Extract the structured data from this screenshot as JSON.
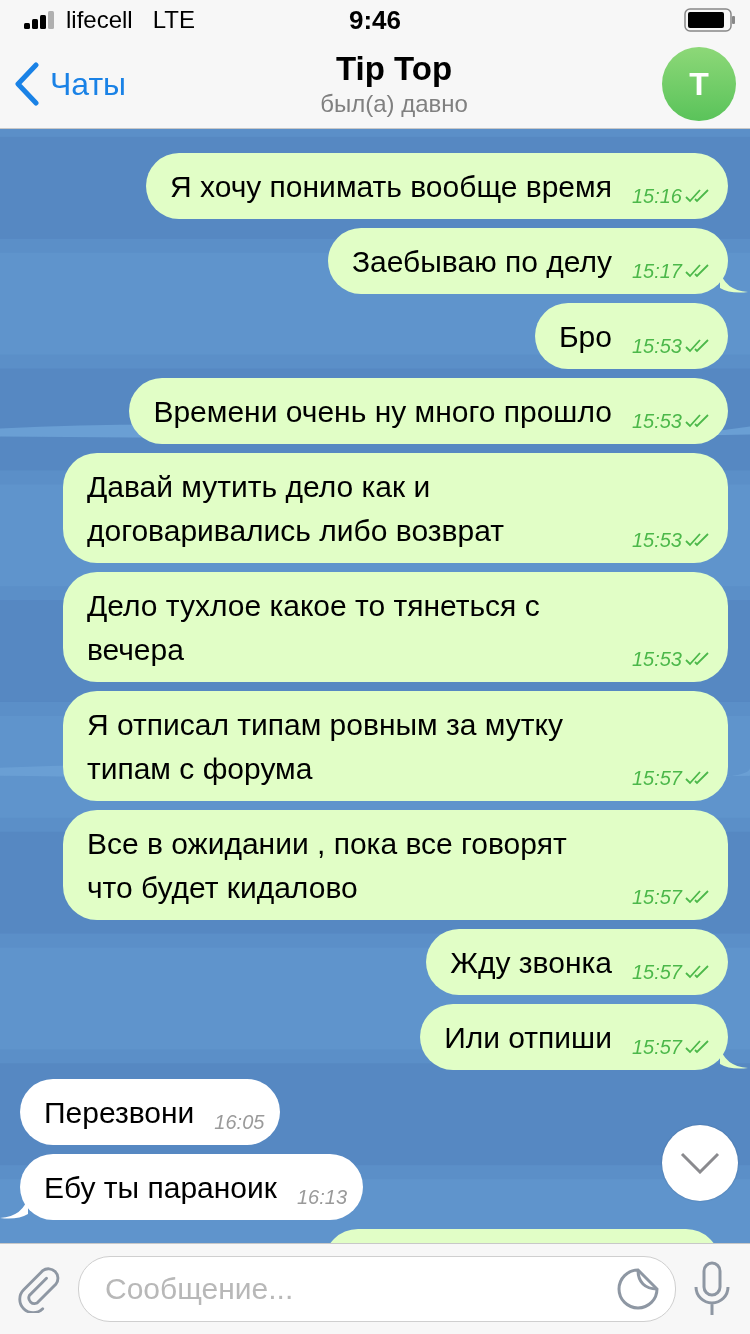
{
  "status_bar": {
    "carrier": "lifecell",
    "network": "LTE",
    "time": "9:46"
  },
  "header": {
    "back_label": "Чаты",
    "title": "Tip Top",
    "subtitle": "был(а) давно",
    "avatar_letter": "T"
  },
  "chat": {
    "messages": [
      {
        "kind": "outgoing",
        "text": "Я хочу понимать вообще время",
        "time": "15:16",
        "read": true,
        "tail": false
      },
      {
        "kind": "outgoing",
        "text": "Заебываю по делу",
        "time": "15:17",
        "read": true,
        "tail": true
      },
      {
        "kind": "outgoing",
        "text": "Бро",
        "time": "15:53",
        "read": true,
        "tail": false
      },
      {
        "kind": "outgoing",
        "text": "Времени очень ну много прошло",
        "time": "15:53",
        "read": true,
        "tail": false
      },
      {
        "kind": "outgoing",
        "text": "Давай мутить дело как и договаривались либо возврат",
        "time": "15:53",
        "read": true,
        "tail": false
      },
      {
        "kind": "outgoing",
        "text": "Дело тухлое какое то тянеться с вечера",
        "time": "15:53",
        "read": true,
        "tail": false
      },
      {
        "kind": "outgoing",
        "text": "Я отписал типам ровным за мутку типам с форума",
        "time": "15:57",
        "read": true,
        "tail": false
      },
      {
        "kind": "outgoing",
        "text": "Все в ожидании , пока все говорят что будет кидалово",
        "time": "15:57",
        "read": true,
        "tail": false
      },
      {
        "kind": "outgoing",
        "text": "Жду звонка",
        "time": "15:57",
        "read": true,
        "tail": false
      },
      {
        "kind": "outgoing",
        "text": "Или отпиши",
        "time": "15:57",
        "read": true,
        "tail": true
      },
      {
        "kind": "incoming",
        "text": "Перезвони",
        "time": "16:05",
        "tail": false
      },
      {
        "kind": "incoming",
        "text": "Ебу ты параноик",
        "time": "16:13",
        "tail": true
      }
    ],
    "more_below": true,
    "scroll_down_button": true
  },
  "composer": {
    "placeholder": "Сообщение..."
  }
}
